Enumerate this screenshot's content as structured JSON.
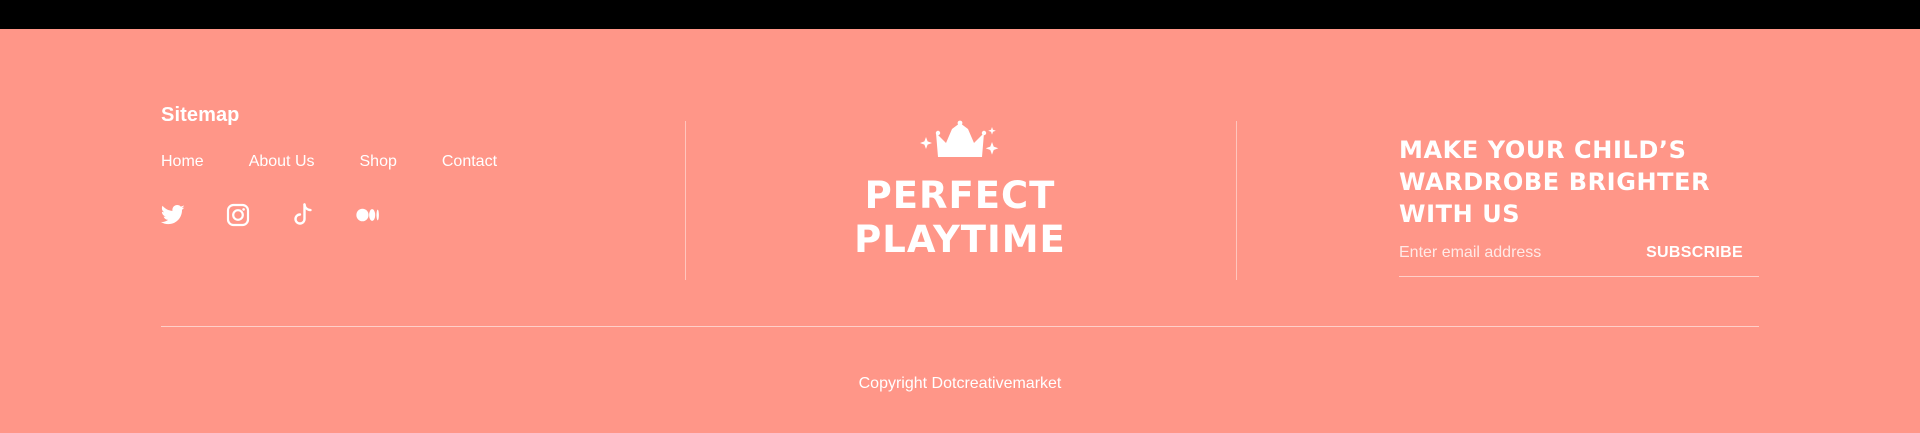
{
  "sitemap": {
    "title": "Sitemap",
    "links": [
      "Home",
      "About Us",
      "Shop",
      "Contact"
    ]
  },
  "social": {
    "icons": [
      "twitter-icon",
      "instagram-icon",
      "tiktok-icon",
      "medium-icon"
    ]
  },
  "logo": {
    "line1": "PERFECT",
    "line2": "PLAYTIME"
  },
  "newsletter": {
    "heading_line1": "MAKE YOUR CHILD’S",
    "heading_line2": "WARDROBE BRIGHTER",
    "heading_line3": "WITH US",
    "email_placeholder": "Enter email address",
    "subscribe_label": "SUBSCRIBE"
  },
  "footer": {
    "copyright": "Copyright Dotcreativemarket"
  },
  "colors": {
    "background": "#ff9688",
    "text": "#ffffff",
    "topbar": "#000000"
  }
}
